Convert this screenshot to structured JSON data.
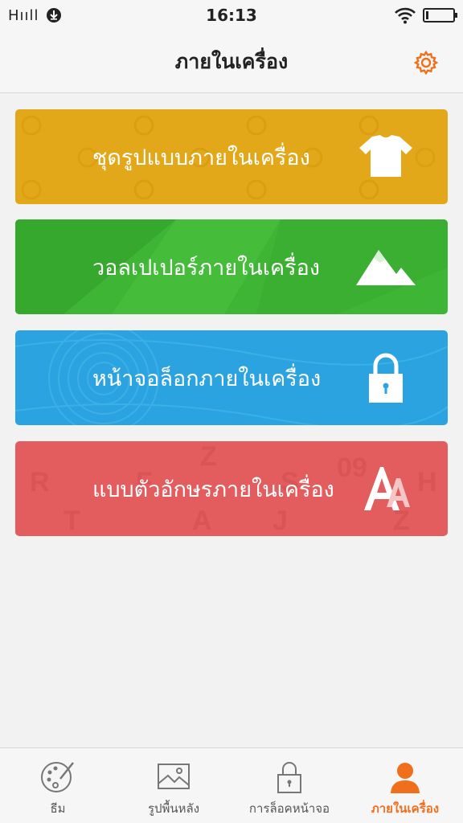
{
  "statusbar": {
    "network": "Hııll",
    "time": "16:13",
    "download_icon": "download-circle-icon",
    "wifi_icon": "wifi-icon",
    "battery_level": 0.1
  },
  "header": {
    "title": "ภายในเครื่อง",
    "settings_icon": "gear-icon",
    "accent": "#ef6f1c"
  },
  "cards": [
    {
      "label": "ชุดรูปแบบภายในเครื่อง",
      "icon": "tshirt-icon",
      "color": "#e3a81a"
    },
    {
      "label": "วอลเปเปอร์ภายในเครื่อง",
      "icon": "mountain-icon",
      "color": "#3eb535"
    },
    {
      "label": "หน้าจอล็อกภายในเครื่อง",
      "icon": "padlock-icon",
      "color": "#2ba3e0"
    },
    {
      "label": "แบบตัวอักษรภายในเครื่อง",
      "icon": "letter-a-icon",
      "color": "#e35d5e"
    }
  ],
  "nav": [
    {
      "label": "ธีม",
      "icon": "palette-icon",
      "active": false
    },
    {
      "label": "รูปพื้นหลัง",
      "icon": "picture-icon",
      "active": false
    },
    {
      "label": "การล็อคหน้าจอ",
      "icon": "lock-icon",
      "active": false
    },
    {
      "label": "ภายในเครื่อง",
      "icon": "person-icon",
      "active": true
    }
  ]
}
